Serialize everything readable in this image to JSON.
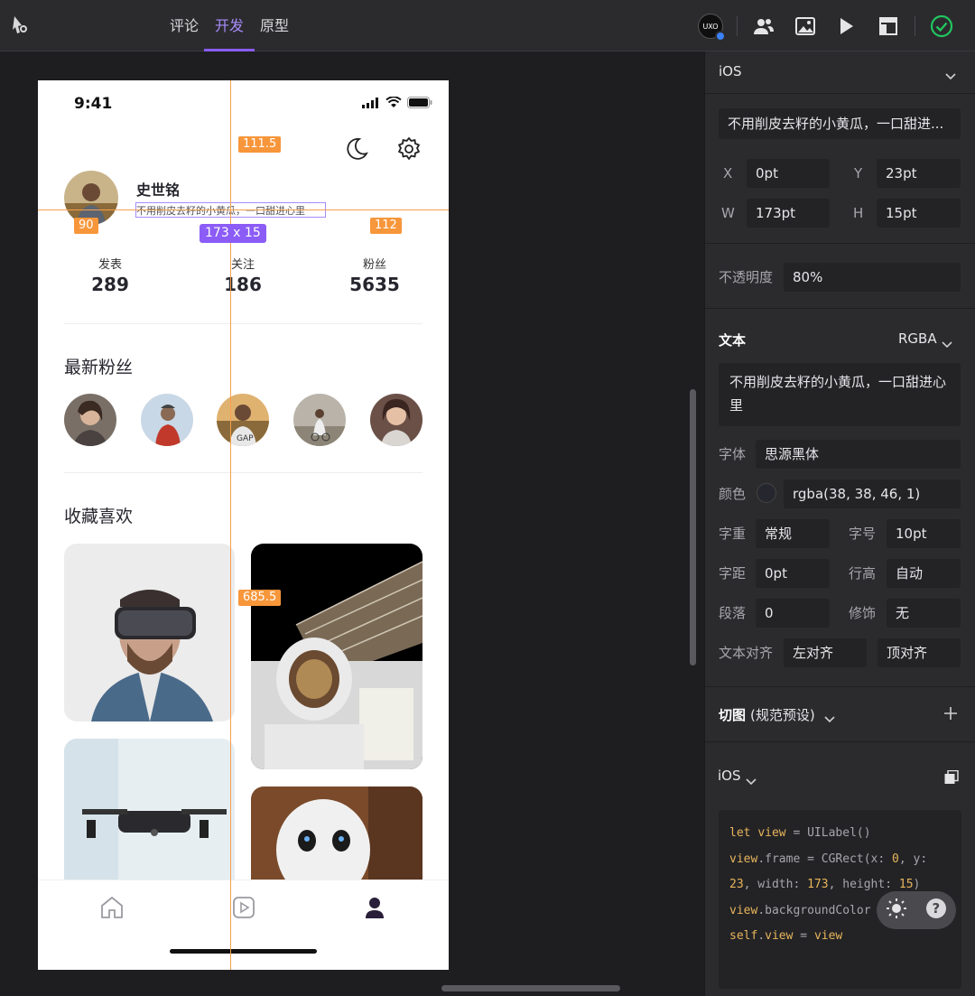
{
  "topbar": {
    "tabs": [
      {
        "label": "评论"
      },
      {
        "label": "开发",
        "active": true
      },
      {
        "label": "原型"
      }
    ],
    "uxo_label": "UXO",
    "icons": [
      "team-icon",
      "image-icon",
      "play-icon",
      "layout-icon",
      "check-circle-icon"
    ]
  },
  "phone": {
    "time": "9:41",
    "username": "史世铭",
    "bio": "不用削皮去籽的小黄瓜，一口甜进心里",
    "stats": [
      {
        "label": "发表",
        "value": "289"
      },
      {
        "label": "关注",
        "value": "186"
      },
      {
        "label": "粉丝",
        "value": "5635"
      }
    ],
    "fans_title": "最新粉丝",
    "favorites_title": "收藏喜欢"
  },
  "measure": {
    "top_distance": "111.5",
    "left_distance": "90",
    "right_distance": "112",
    "size": "173 x 15",
    "bottom_distance": "685.5"
  },
  "panel": {
    "platform": "iOS",
    "layer_name": "不用削皮去籽的小黄瓜，一口甜进...",
    "x_label": "X",
    "x": "0pt",
    "y_label": "Y",
    "y": "23pt",
    "w_label": "W",
    "w": "173pt",
    "h_label": "H",
    "h": "15pt",
    "opacity_label": "不透明度",
    "opacity": "80%",
    "text_heading": "文本",
    "color_mode": "RGBA",
    "text_content": "不用削皮去籽的小黄瓜，一口甜进心里",
    "font_label": "字体",
    "font": "思源黑体",
    "color_label": "颜色",
    "color": "rgba(38, 38, 46, 1)",
    "color_swatch": "#26262e",
    "weight_label": "字重",
    "weight": "常规",
    "size_label": "字号",
    "size": "10pt",
    "spacing_label": "字距",
    "spacing": "0pt",
    "lineheight_label": "行高",
    "lineheight": "自动",
    "paragraph_label": "段落",
    "paragraph": "0",
    "decoration_label": "修饰",
    "decoration": "无",
    "align_label": "文本对齐",
    "align_h": "左对齐",
    "align_v": "顶对齐",
    "slice_heading": "切图",
    "slice_preset": "(规范预设)",
    "code_platform": "iOS",
    "code_lines": [
      "let view = UILabel()",
      "view.frame = CGRect(x: 0, y:",
      "23, width: 173, height: 15)",
      "view.backgroundColor",
      "self.view = view"
    ]
  }
}
